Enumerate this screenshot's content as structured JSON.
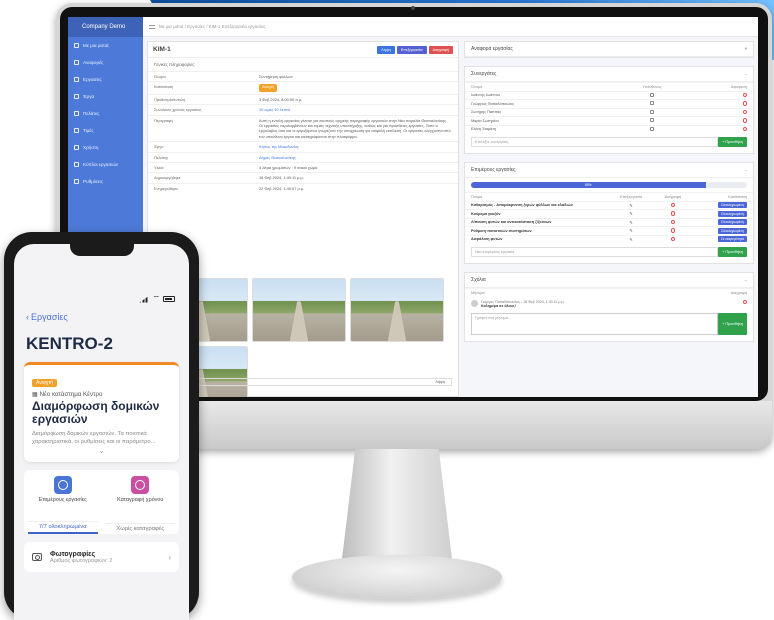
{
  "desktop": {
    "brand": "Company Demo",
    "breadcrumb": "Με μια ματιά / Εργασίες / KIM-1 Επεξεργασία εργασίας",
    "nav": [
      "Με μια ματιά",
      "Αναφορές",
      "Εργασίες",
      "Έργα",
      "Πελάτες",
      "Τιμές",
      "Χρήστη",
      "Κύπλοι εργασιών",
      "Ρυθμίσεις"
    ],
    "main": {
      "title": "KIM-1",
      "buttons": {
        "edit": "Λήψη",
        "edit2": "Επεξεργασία",
        "del": "Διαγραφή"
      },
      "section": "Γενικές πληροφορίες",
      "rows": [
        {
          "k": "Όνομα",
          "v": "Συντήρηση φύλλων"
        },
        {
          "k": "Κατάσταση",
          "v": "Ανοιχτή",
          "badge": true
        },
        {
          "k": "Προθεσμία/εντολή",
          "v": "3 Φεβ 2024, 8:00:00 π.μ."
        },
        {
          "k": "Συνολικός χρόνος εργασίας",
          "v": "10 ώρες 10 λεπτά",
          "link": true
        },
        {
          "k": "Περιγραφή",
          "v": "Αυτή η εντολή εργασίας γίνεται για σκοπούς αρχικής περιγραφής εργασιών στην Νέα παραλία Θεσσαλονίκης. Οι εργασίες περιλαμβάνουν και τομείς τεχνικής υποστήριξης, καθώς και για πρόσθετες εργασίες. Τόσο ο εργολάβος όσο και οι εργαζόμενοι γνωρίζουν την υποχρέωση για ασφαλή εκτέλεση. Οι εργασίες ελέγχονται από τον υπεύθυνο έργου και καταγράφονται στην πλατφόρμα.",
          "tall": true
        },
        {
          "k": "Έργο",
          "v": "Κήπος της Μακεδονίας",
          "link": true
        },
        {
          "k": "Πελάτης",
          "v": "Δήμος Θεσσαλονίκης",
          "link": true
        },
        {
          "k": "Υλικά",
          "v": "4 λίτρα χρωμάτων · 9 σακιά χώμα"
        },
        {
          "k": "Δημιουργήθηκε",
          "v": "18 Φεβ 2024, 1:40:11 μ.μ."
        },
        {
          "k": "Ενημερώθηκε",
          "v": "22 Φεβ 2024, 1:40:07 μ.μ."
        }
      ],
      "photos_label": "Συνημμένα",
      "footer": "Λήψη"
    },
    "summary": {
      "title": "Αναφορά εργασίας"
    },
    "workers": {
      "title": "Συνεργάτες",
      "headers": [
        "Όνομα",
        "Υπεύθυνος",
        "Αφαίρεση"
      ],
      "rows": [
        "Ιωάννης Ιωάννου",
        "Γεώργιος Παπαδόπουλος",
        "Σωτήρης Παππάς",
        "Μαρία Σωτηρίου",
        "Ελένη Σταμάτη"
      ],
      "placeholder": "Επιλέξτε συνεργάτη",
      "add": "+ Προσθήκη"
    },
    "subtasks": {
      "title": "Επιμέρους εργασίες",
      "progress": "85%",
      "progress_value": 0.85,
      "headers": [
        "Όνομα",
        "Επεξεργασία",
        "Διαγραφή",
        "Κατάσταση"
      ],
      "rows": [
        {
          "n": "Καθαρισμός - Απομάκρυνση ξερών φύλλων και κλαδιών",
          "s": "Ολοκληρωμένη"
        },
        {
          "n": "Κούρεμα γκαζόν",
          "s": "Ολοκληρωμένη"
        },
        {
          "n": "Λίπανση φυτών και αντικατάσταση ζ/ζούνων",
          "s": "Ολοκληρωμένη"
        },
        {
          "n": "Ρύθμιση ποτιστικών συστημάτων",
          "s": "Ολοκληρωμένη"
        },
        {
          "n": "Ασφάλιση φυτών",
          "s": "Σε εκκρεμότητα"
        }
      ],
      "placeholder": "Νέα επιμέρους εργασία",
      "add": "+ Προσθήκη"
    },
    "comments": {
      "title": "Σχόλια",
      "headers": [
        "Μήνυμα",
        "Διαγραφή"
      ],
      "author": "Γιώργος Παπαδόπουλος - 18 Φεβ 2024, 1:40:11 μ.μ.",
      "text": "Καλημέρα σε όλους!",
      "placeholder": "Γράψτε ένα μήνυμα...",
      "add": "+ Προσθήκη"
    }
  },
  "phone": {
    "back": "Εργασίες",
    "title": "KENTRO-2",
    "badge": "Ανοιχτή",
    "location": "Νέο κατάστημα Κέντρο",
    "heading": "Διαμόρφωση δομικών εργασιών",
    "desc": "Διαμόρφωση δομικών εργασιών. Τα ποιοτικά χαρακτηριστικά, οι ρυθμίσεις και οι παράμετρο...",
    "tile1": {
      "label": "Επιμέρους εργασίες",
      "foot": "7/7 ολοκληρωμένα",
      "color": "#4a74d6"
    },
    "tile2": {
      "label": "Καταγραφή χρόνου",
      "foot": "Χωρίς καταγραφές",
      "color": "#c94fa3"
    },
    "photos": {
      "title": "Φωτογραφίες",
      "sub": "Αριθμός φωτογραφιών: 2"
    }
  }
}
